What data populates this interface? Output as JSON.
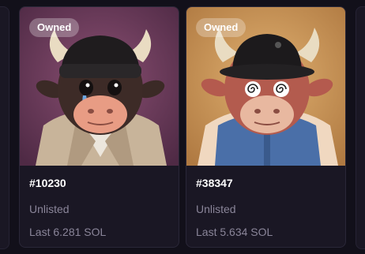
{
  "cards": [
    {
      "badge": "Owned",
      "token_id": "#10230",
      "status": "Unlisted",
      "last_price": "Last 6.281 SOL",
      "background_color": "#6e3d5c",
      "hat": "black-beanie",
      "outfit": "trench-coat"
    },
    {
      "badge": "Owned",
      "token_id": "#38347",
      "status": "Unlisted",
      "last_price": "Last 5.634 SOL",
      "background_color": "#c9935a",
      "hat": "black-bucket-hat",
      "outfit": "varsity-jacket"
    }
  ],
  "colors": {
    "page_background": "#12101a",
    "card_background": "#1a1724",
    "title_text": "#ffffff",
    "muted_text": "#8a8599"
  }
}
